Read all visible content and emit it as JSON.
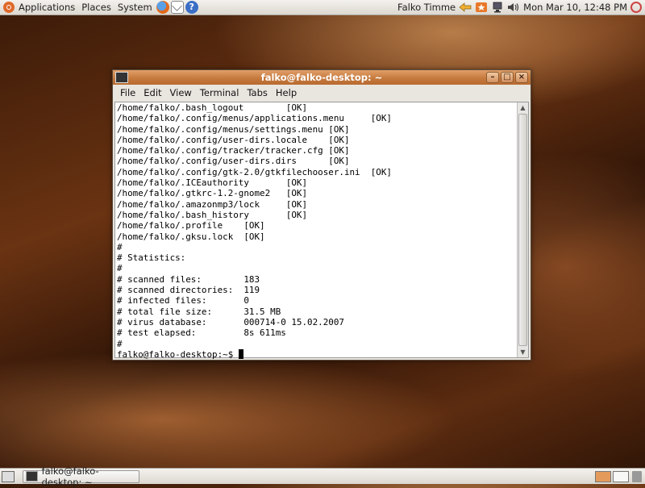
{
  "top_panel": {
    "menus": [
      "Applications",
      "Places",
      "System"
    ],
    "user": "Falko Timme",
    "clock": "Mon Mar 10, 12:48 PM"
  },
  "window": {
    "title": "falko@falko-desktop: ~",
    "menu": [
      "File",
      "Edit",
      "View",
      "Terminal",
      "Tabs",
      "Help"
    ],
    "terminal_lines": [
      "/home/falko/.bash_logout        [OK]",
      "/home/falko/.config/menus/applications.menu     [OK]",
      "/home/falko/.config/menus/settings.menu [OK]",
      "/home/falko/.config/user-dirs.locale    [OK]",
      "/home/falko/.config/tracker/tracker.cfg [OK]",
      "/home/falko/.config/user-dirs.dirs      [OK]",
      "/home/falko/.config/gtk-2.0/gtkfilechooser.ini  [OK]",
      "/home/falko/.ICEauthority       [OK]",
      "/home/falko/.gtkrc-1.2-gnome2   [OK]",
      "/home/falko/.amazonmp3/lock     [OK]",
      "/home/falko/.bash_history       [OK]",
      "/home/falko/.profile    [OK]",
      "/home/falko/.gksu.lock  [OK]",
      "#",
      "# Statistics:",
      "#",
      "# scanned files:        183",
      "# scanned directories:  119",
      "# infected files:       0",
      "# total file size:      31.5 MB",
      "# virus database:       000714-0 15.02.2007",
      "# test elapsed:         8s 611ms",
      "#"
    ],
    "prompt": "falko@falko-desktop:~$ "
  },
  "bottom_panel": {
    "task_label": "falko@falko-desktop: ~"
  }
}
